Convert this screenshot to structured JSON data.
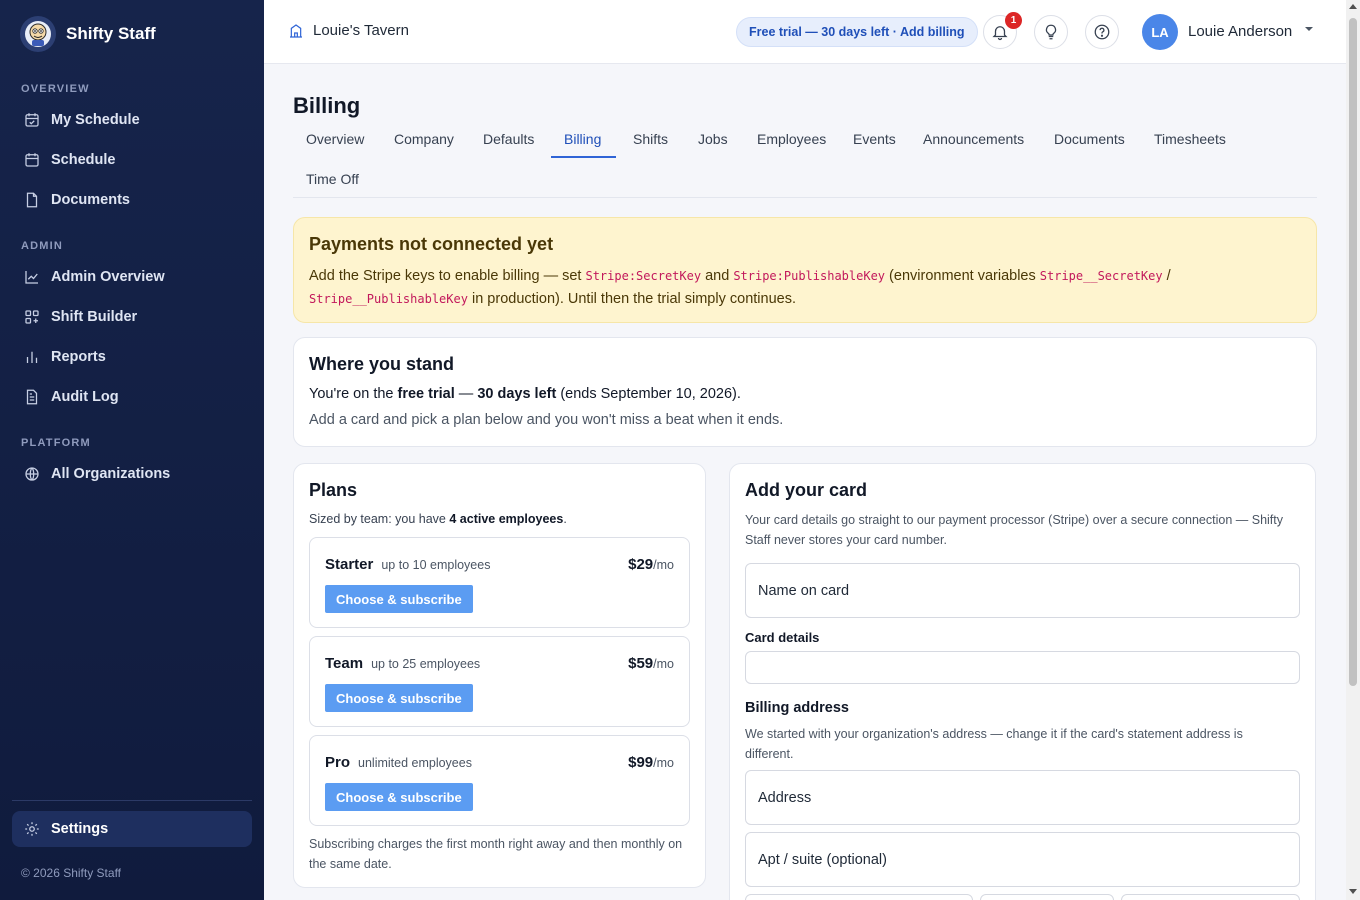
{
  "brand": {
    "name": "Shifty Staff"
  },
  "sidebar": {
    "sections": [
      {
        "title": "OVERVIEW"
      },
      {
        "title": "ADMIN"
      },
      {
        "title": "PLATFORM"
      }
    ],
    "items": [
      {
        "label": "My Schedule",
        "icon": "calendar-check-icon"
      },
      {
        "label": "Schedule",
        "icon": "calendar-icon"
      },
      {
        "label": "Documents",
        "icon": "document-icon"
      },
      {
        "label": "Admin Overview",
        "icon": "line-chart-icon"
      },
      {
        "label": "Shift Builder",
        "icon": "grid-icon"
      },
      {
        "label": "Reports",
        "icon": "bar-chart-icon"
      },
      {
        "label": "Audit Log",
        "icon": "file-text-icon"
      },
      {
        "label": "All Organizations",
        "icon": "globe-icon"
      }
    ],
    "settings": {
      "label": "Settings",
      "icon": "gear-icon"
    },
    "footer": "© 2026 Shifty Staff"
  },
  "topbar": {
    "org_name": "Louie's Tavern",
    "trial_pill": "Free trial — 30 days left · Add billing",
    "notifications_count": "1",
    "user_initials": "LA",
    "user_name": "Louie Anderson"
  },
  "page": {
    "title": "Billing",
    "tabs": [
      "Overview",
      "Company",
      "Defaults",
      "Billing",
      "Shifts",
      "Jobs",
      "Employees",
      "Events",
      "Announcements",
      "Documents",
      "Timesheets",
      "Time Off"
    ],
    "active_tab": "Billing"
  },
  "warning": {
    "title": "Payments not connected yet",
    "t1": "Add the Stripe keys to enable billing — set ",
    "c1": "Stripe:SecretKey",
    "t2": " and ",
    "c2": "Stripe:PublishableKey",
    "t3": " (environment variables ",
    "c3": "Stripe__SecretKey",
    "t4": " / ",
    "c4": "Stripe__PublishableKey",
    "t5": " in production). Until then the trial simply continues."
  },
  "stand": {
    "title": "Where you stand",
    "l1a": "You're on the ",
    "l1b": "free trial",
    "l1c": " — ",
    "l1d": "30 days left",
    "l1e": " (ends September 10, 2026).",
    "l2": "Add a card and pick a plan below and you won't miss a beat when it ends."
  },
  "plans": {
    "title": "Plans",
    "sub_a": "Sized by team: you have ",
    "sub_b": "4 active employees",
    "sub_c": ".",
    "items": [
      {
        "name": "Starter",
        "limit": "up to 10 employees",
        "price": "$29",
        "period": "/mo",
        "button": "Choose & subscribe"
      },
      {
        "name": "Team",
        "limit": "up to 25 employees",
        "price": "$59",
        "period": "/mo",
        "button": "Choose & subscribe"
      },
      {
        "name": "Pro",
        "limit": "unlimited employees",
        "price": "$99",
        "period": "/mo",
        "button": "Choose & subscribe"
      }
    ],
    "footnote": "Subscribing charges the first month right away and then monthly on the same date."
  },
  "card_form": {
    "title": "Add your card",
    "description": "Your card details go straight to our payment processor (Stripe) over a secure connection — Shifty Staff never stores your card number.",
    "name_placeholder": "Name on card",
    "card_details_label": "Card details",
    "billing_title": "Billing address",
    "billing_desc": "We started with your organization's address — change it if the card's statement address is different.",
    "address_placeholder": "Address",
    "apt_placeholder": "Apt / suite (optional)"
  },
  "colors": {
    "accent": "#2f64d6",
    "sidebar_bg": "#16244b",
    "warning_bg": "#fef4cf",
    "button": "#5b9cf2"
  }
}
